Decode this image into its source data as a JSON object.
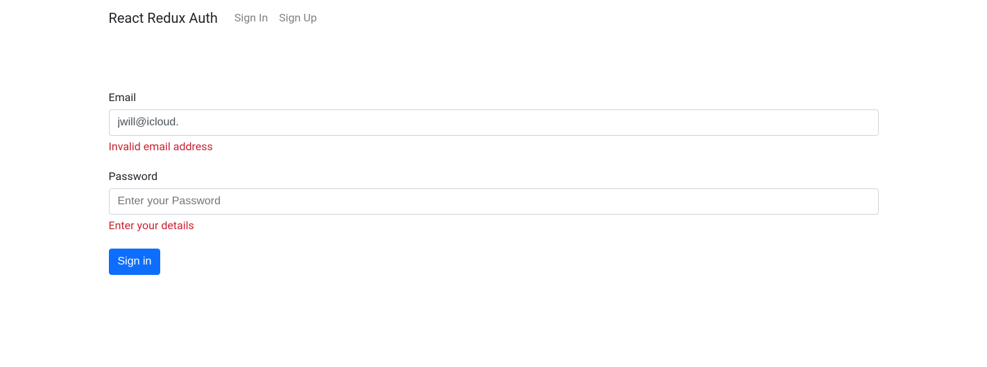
{
  "nav": {
    "brand": "React Redux Auth",
    "links": {
      "signin": "Sign In",
      "signup": "Sign Up"
    }
  },
  "form": {
    "email": {
      "label": "Email",
      "value": "jwill@icloud.",
      "error": "Invalid email address"
    },
    "password": {
      "label": "Password",
      "placeholder": "Enter your Password",
      "error": "Enter your details"
    },
    "submit_label": "Sign in"
  }
}
